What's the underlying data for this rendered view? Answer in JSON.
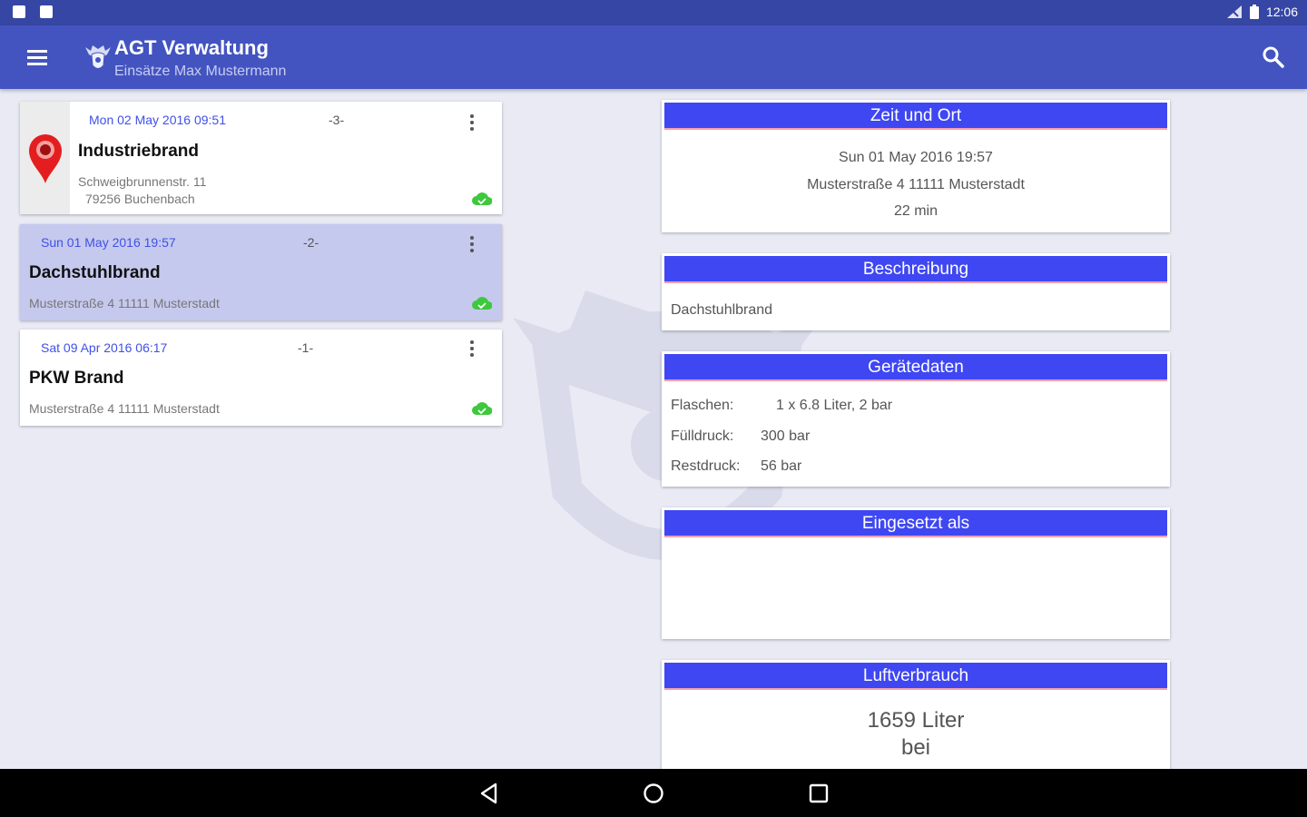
{
  "status_bar": {
    "time": "12:06"
  },
  "app_bar": {
    "title": "AGT Verwaltung",
    "subtitle": "Einsätze Max Mustermann",
    "color": "#4354c0"
  },
  "list": [
    {
      "date": "Mon 02 May 2016  09:51",
      "number": "-3-",
      "title": "Industriebrand",
      "address_line1": "Schweigbrunnenstr. 11",
      "address_line2": "79256 Buchenbach",
      "selected": false
    },
    {
      "date": "Sun 01 May 2016  19:57",
      "number": "-2-",
      "title": "Dachstuhlbrand",
      "address_line1": "Musterstraße 4 11111 Musterstadt",
      "selected": true
    },
    {
      "date": "Sat 09 Apr 2016  06:17",
      "number": "-1-",
      "title": "PKW Brand",
      "address_line1": "Musterstraße 4 11111 Musterstadt",
      "selected": false
    }
  ],
  "detail": {
    "zeit_ort": {
      "header": "Zeit und Ort",
      "datetime": "Sun 01 May 2016  19:57",
      "address": "Musterstraße 4 11111 Musterstadt",
      "duration": "22 min"
    },
    "beschreibung": {
      "header": "Beschreibung",
      "text": "Dachstuhlbrand"
    },
    "geraetedaten": {
      "header": "Gerätedaten",
      "rows": [
        {
          "label": "Flaschen:",
          "value": "1 x 6.8 Liter, 2 bar"
        },
        {
          "label": "Fülldruck:",
          "value": "300 bar"
        },
        {
          "label": "Restdruck:",
          "value": "56 bar"
        }
      ]
    },
    "eingesetzt_als": {
      "header": "Eingesetzt als"
    },
    "luftverbrauch": {
      "header": "Luftverbrauch",
      "value": "1659 Liter",
      "line2": "bei"
    }
  },
  "colors": {
    "header_blue": "#3f47f2",
    "accent_blue": "#3f51e6",
    "cloud_green": "#3ec83c",
    "pin_red": "#e41e1e"
  }
}
